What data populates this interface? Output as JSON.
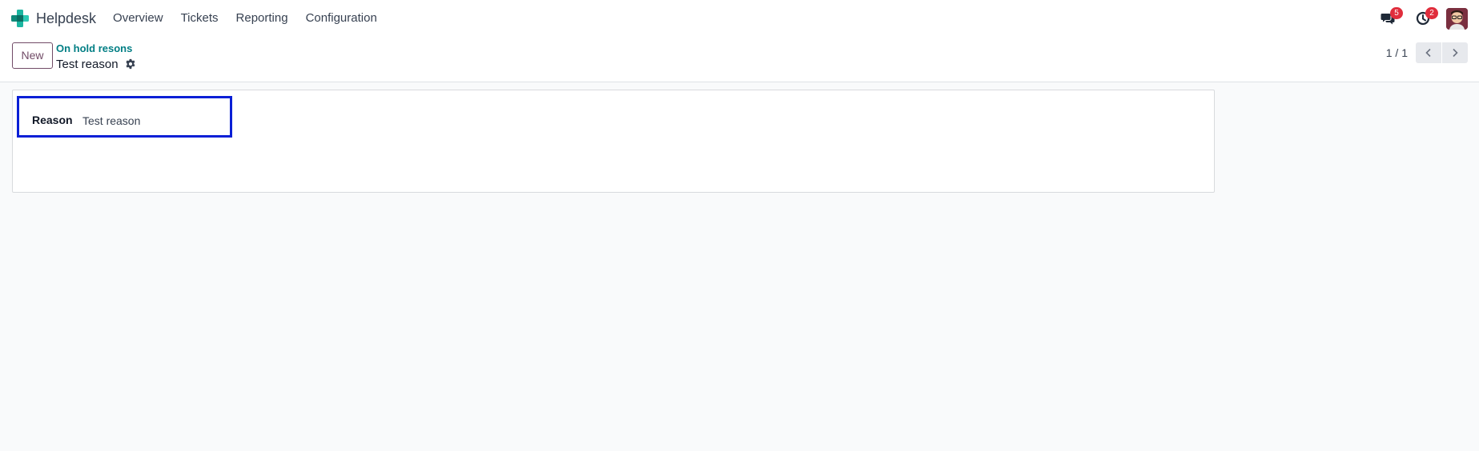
{
  "navbar": {
    "app_name": "Helpdesk",
    "menu": [
      {
        "label": "Overview"
      },
      {
        "label": "Tickets"
      },
      {
        "label": "Reporting"
      },
      {
        "label": "Configuration"
      }
    ],
    "messages_badge": "5",
    "activities_badge": "2",
    "icons": {
      "app_logo": "helpdesk-logo-icon",
      "messages": "chat-bubbles-icon",
      "activities": "clock-icon",
      "avatar": "user-avatar"
    },
    "colors": {
      "brand_teal": "#1ab5a0",
      "badge_red": "#e02d3c"
    }
  },
  "control_panel": {
    "new_button_label": "New",
    "breadcrumb_parent": "On hold resons",
    "breadcrumb_current": "Test reason",
    "pager_value": "1 / 1",
    "colors": {
      "primary": "#714b67",
      "link": "#017e84"
    }
  },
  "form": {
    "reason_label": "Reason",
    "reason_value": "Test reason",
    "highlight_color": "#0a1fd6"
  }
}
